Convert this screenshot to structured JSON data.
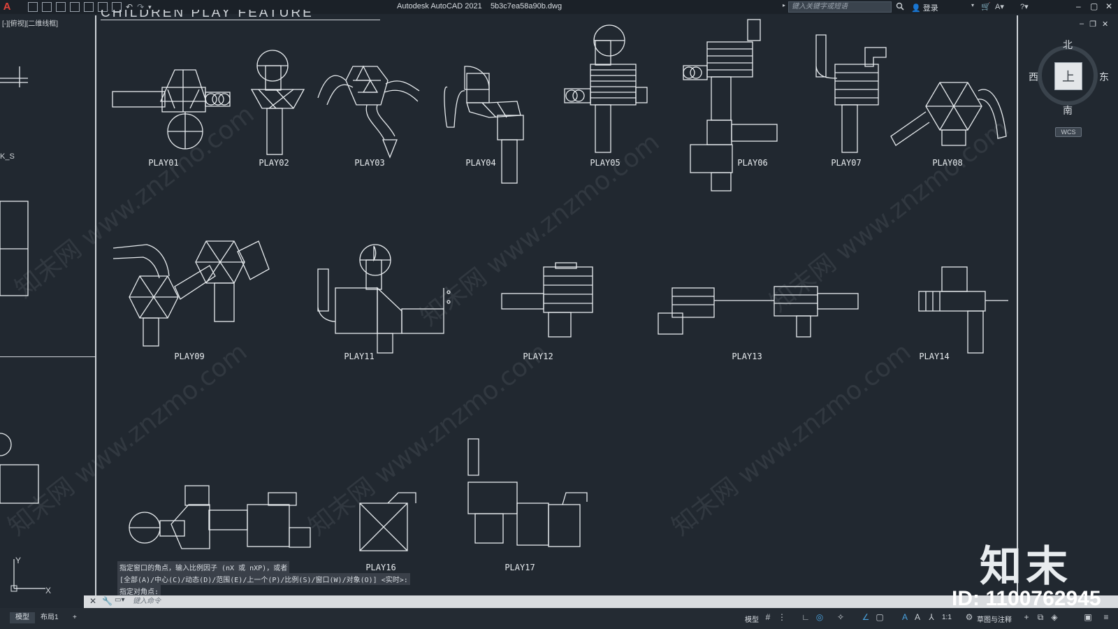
{
  "titlebar": {
    "title": "Autodesk AutoCAD 2021",
    "filename": "5b3c7ea58a90b.dwg",
    "search_placeholder": "键入关键字或短语",
    "login": "登录"
  },
  "viewport_label": "[-][俯视][二维线框]",
  "left_panel_fragment": "K_S",
  "title_fragment": "CHILDREN PLAY FEATURE",
  "labels": [
    "PLAY01",
    "PLAY02",
    "PLAY03",
    "PLAY04",
    "PLAY05",
    "PLAY06",
    "PLAY07",
    "PLAY08",
    "PLAY09",
    "PLAY11",
    "PLAY12",
    "PLAY13",
    "PLAY14",
    "PLAY16",
    "PLAY17"
  ],
  "viewcube": {
    "north": "北",
    "south": "南",
    "east": "东",
    "west": "西",
    "face": "上",
    "wcs": "WCS"
  },
  "command_history": [
    "指定窗口的角点，输入比例因子 (nX 或 nXP)，或者",
    "[全部(A)/中心(C)/动态(D)/范围(E)/上一个(P)/比例(S)/窗口(W)/对象(O)] <实时>:",
    "指定对角点:"
  ],
  "command_placeholder": "键入命令",
  "tabs": {
    "model": "模型",
    "layout": "布局1",
    "add": "+"
  },
  "status": {
    "model": "模型",
    "scale": "1:1",
    "workspace": "草图与注释"
  },
  "watermark": {
    "brand": "知末",
    "id": "ID: 1100762945",
    "site": "知末网 www.znzmo.com"
  },
  "ucs": {
    "x": "X",
    "y": "Y"
  },
  "colors": {
    "background": "#212830",
    "lines": "#e8ecef",
    "titlebar": "#1b2128"
  }
}
